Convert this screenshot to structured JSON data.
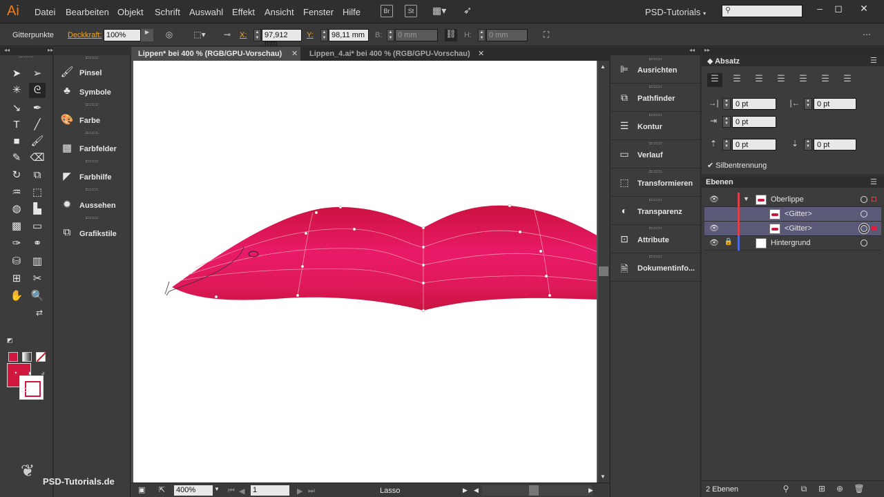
{
  "app": {
    "logo": "Ai",
    "workspace": "PSD-Tutorials"
  },
  "menu": [
    "Datei",
    "Bearbeiten",
    "Objekt",
    "Schrift",
    "Auswahl",
    "Effekt",
    "Ansicht",
    "Fenster",
    "Hilfe"
  ],
  "menu_buttons": {
    "bridge": "Br",
    "stock": "St"
  },
  "controlbar": {
    "mode": "Gitterpunkte",
    "opacity_label": "Deckkraft:",
    "opacity_value": "100%",
    "x_label": "X:",
    "x_value": "97,912 mm",
    "y_label": "Y:",
    "y_value": "98,11 mm",
    "w_label": "B:",
    "w_value": "0 mm",
    "h_label": "H:",
    "h_value": "0 mm"
  },
  "tabs": [
    {
      "label": "Lippen* bei 400 % (RGB/GPU-Vorschau)",
      "active": true
    },
    {
      "label": "Lippen_4.ai* bei 400 % (RGB/GPU-Vorschau)",
      "active": false
    }
  ],
  "left_panels": [
    "Pinsel",
    "Symbole",
    "Farbe",
    "Farbfelder",
    "Farbhilfe",
    "Aussehen",
    "Grafikstile"
  ],
  "mid_panels": [
    "Ausrichten",
    "Pathfinder",
    "Kontur",
    "Verlauf",
    "Transformieren",
    "Transparenz",
    "Attribute",
    "Dokumentinfo..."
  ],
  "absatz": {
    "title": "Absatz",
    "indent_left": "0 pt",
    "indent_right": "0 pt",
    "first_line": "0 pt",
    "space_before": "0 pt",
    "space_after": "0 pt",
    "hyphenation": "Silbentrennung"
  },
  "ebenen": {
    "title": "Ebenen",
    "layers": [
      {
        "name": "Oberlippe"
      },
      {
        "name": "<Gitter>"
      },
      {
        "name": "<Gitter>"
      },
      {
        "name": "Hintergrund"
      }
    ],
    "count": "2 Ebenen"
  },
  "status": {
    "zoom": "400%",
    "page": "1",
    "tool": "Lasso"
  },
  "watermark": "PSD-Tutorials.de",
  "colors": {
    "fill": "#d2173f",
    "lips_dark": "#d01542",
    "lips_light": "#ea1a6a",
    "accent": "#ff7c00"
  }
}
